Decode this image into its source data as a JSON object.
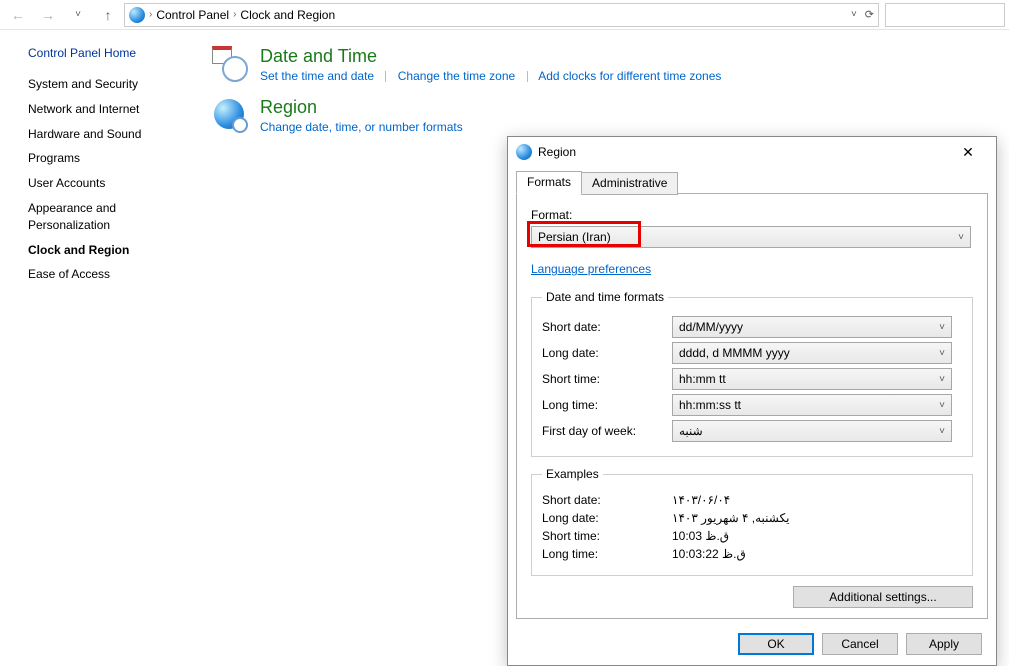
{
  "addressbar": {
    "crumbs": [
      "Control Panel",
      "Clock and Region"
    ]
  },
  "sidebar": {
    "home": "Control Panel Home",
    "items": [
      "System and Security",
      "Network and Internet",
      "Hardware and Sound",
      "Programs",
      "User Accounts",
      "Appearance and Personalization",
      "Clock and Region",
      "Ease of Access"
    ],
    "current_index": 6
  },
  "sections": {
    "datetime": {
      "title": "Date and Time",
      "links": [
        "Set the time and date",
        "Change the time zone",
        "Add clocks for different time zones"
      ]
    },
    "region": {
      "title": "Region",
      "links": [
        "Change date, time, or number formats"
      ]
    }
  },
  "dialog": {
    "title": "Region",
    "tabs": [
      "Formats",
      "Administrative"
    ],
    "active_tab": 0,
    "format_label": "Format:",
    "format_value": "Persian (Iran)",
    "lang_prefs": "Language preferences",
    "group_formats_title": "Date and time formats",
    "rows": [
      {
        "label": "Short date:",
        "value": "dd/MM/yyyy"
      },
      {
        "label": "Long date:",
        "value": "dddd, d MMMM yyyy"
      },
      {
        "label": "Short time:",
        "value": "hh:mm tt"
      },
      {
        "label": "Long time:",
        "value": "hh:mm:ss tt"
      },
      {
        "label": "First day of week:",
        "value": "شنبه"
      }
    ],
    "group_examples_title": "Examples",
    "examples": [
      {
        "label": "Short date:",
        "value": "۱۴۰۳/۰۶/۰۴"
      },
      {
        "label": "Long date:",
        "value": "یکشنبه, ۴ شهریور ۱۴۰۳"
      },
      {
        "label": "Short time:",
        "value": "10:03 ق.ظ"
      },
      {
        "label": "Long time:",
        "value": "10:03:22 ق.ظ"
      }
    ],
    "additional_settings": "Additional settings...",
    "buttons": {
      "ok": "OK",
      "cancel": "Cancel",
      "apply": "Apply"
    }
  }
}
